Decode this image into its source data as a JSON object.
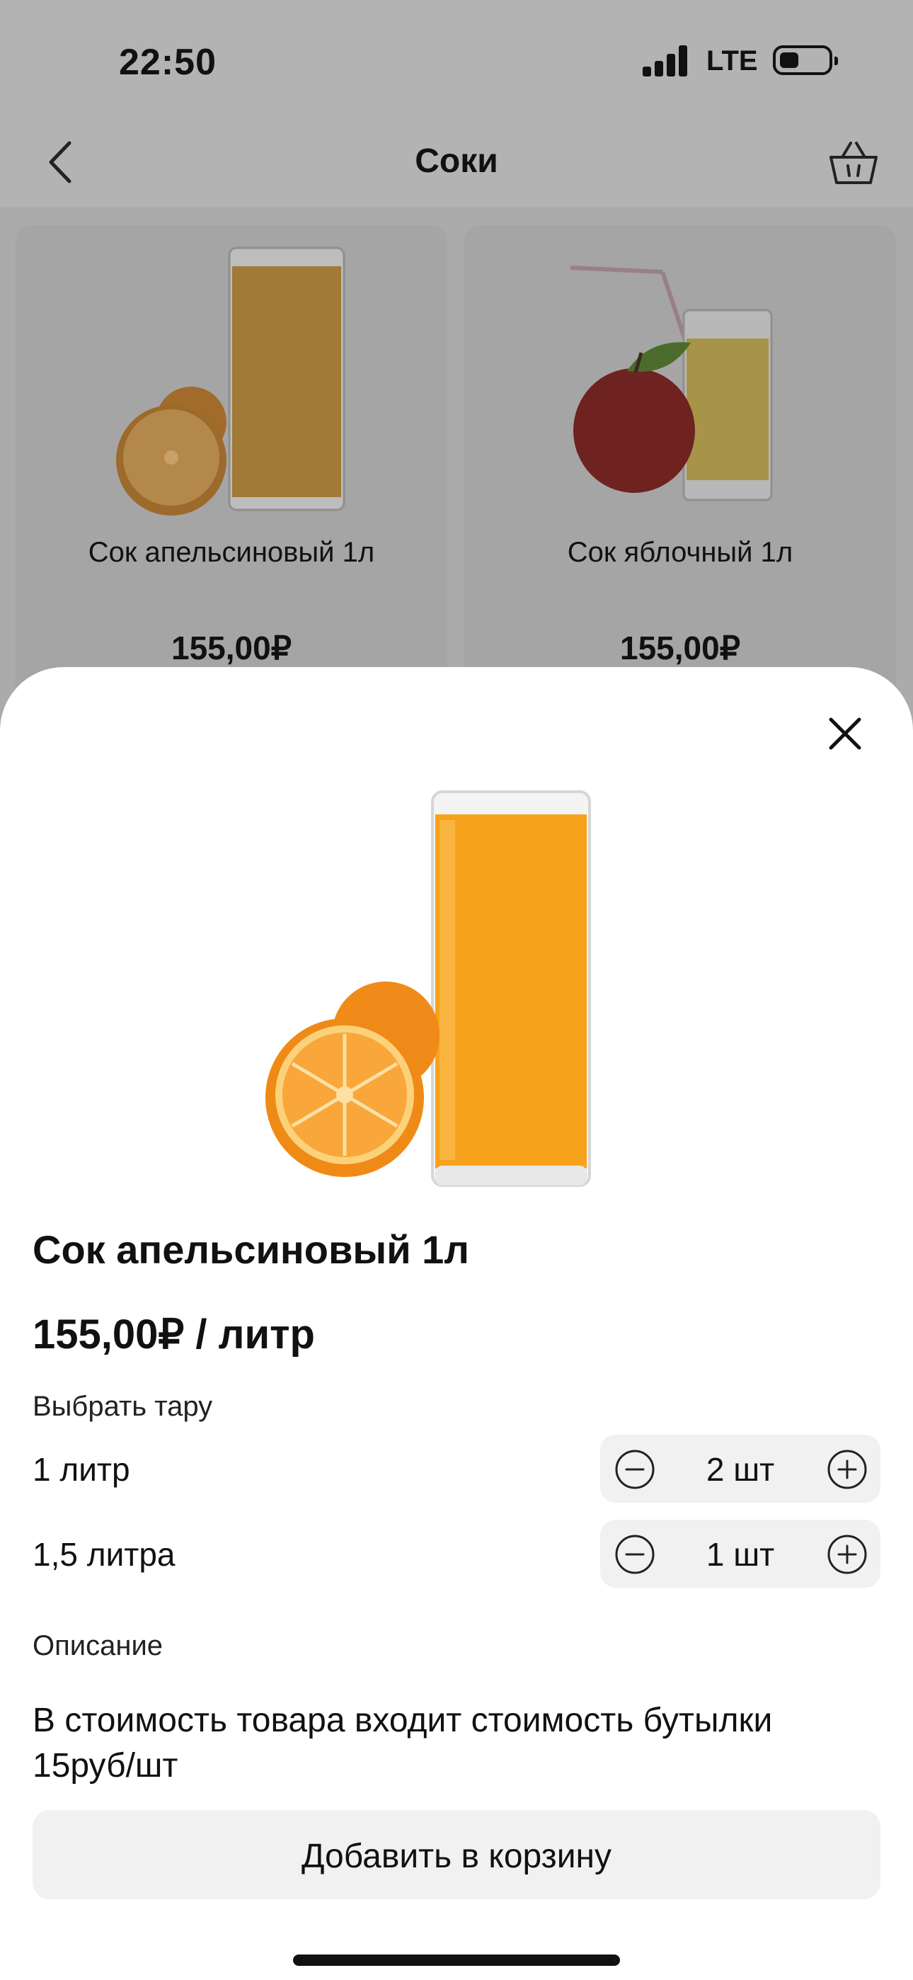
{
  "status_bar": {
    "time": "22:50",
    "network": "LTE"
  },
  "nav": {
    "title": "Соки",
    "back_icon": "chevron-left-icon",
    "cart_icon": "basket-icon"
  },
  "products": [
    {
      "name": "Сок апельсиновый 1л",
      "price": "155,00₽",
      "image": "orange-juice-glass"
    },
    {
      "name": "Сок яблочный 1л",
      "price": "155,00₽",
      "image": "apple-juice-glass"
    }
  ],
  "sheet": {
    "close_icon": "close-icon",
    "title": "Сок апельсиновый 1л",
    "price": "155,00₽ / литр",
    "container_label": "Выбрать тару",
    "options": [
      {
        "label": "1 литр",
        "quantity": "2 шт"
      },
      {
        "label": "1,5 литра",
        "quantity": "1 шт"
      }
    ],
    "description_label": "Описание",
    "description": "В стоимость товара входит стоимость бутылки 15руб/шт",
    "add_button": "Добавить в корзину"
  },
  "colors": {
    "juice": "#f7a21b",
    "orange": "#f5901e",
    "apple": "#b7261f",
    "sheet_bg": "#ffffff",
    "control_bg": "#f1f1f1"
  }
}
